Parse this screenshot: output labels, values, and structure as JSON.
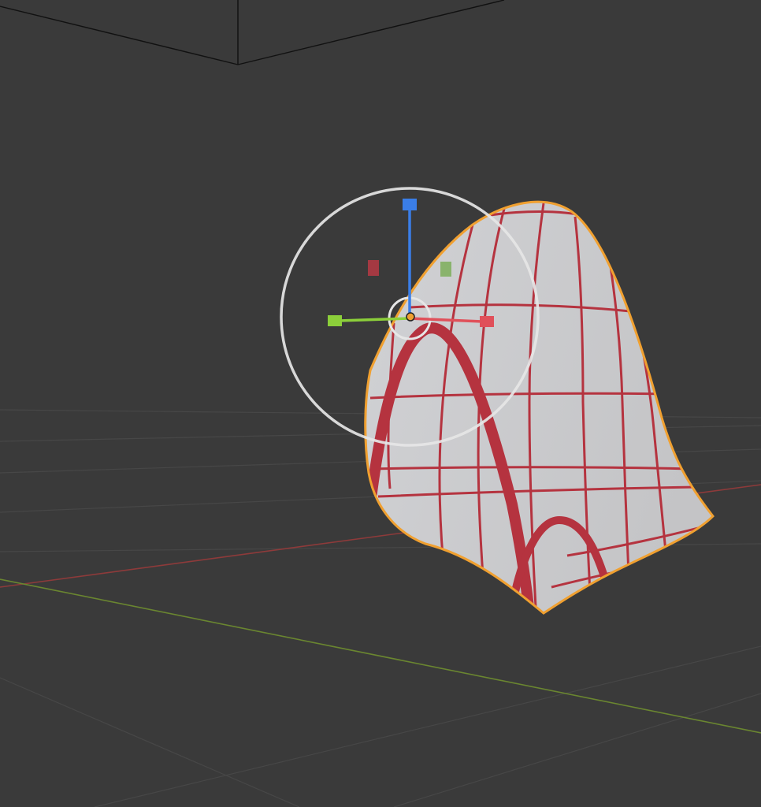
{
  "viewport": {
    "background": "#3a3a3a",
    "grid_color": "#4a4a4a",
    "axis_x_color": "#a23a3a",
    "axis_y_color": "#6f8c2a"
  },
  "object": {
    "surface_color": "#c9c9cc",
    "outline_color": "#f0a030",
    "wire_color": "#b5333f"
  },
  "gizmo": {
    "ring_color": "#e6e6e6",
    "x_axis_color": "#e0505a",
    "y_axis_color": "#8ccf3a",
    "z_axis_color": "#3a7ee8",
    "plane_xz_color": "#b03a44",
    "plane_yz_color": "#7dae5a",
    "origin_color": "#f0a030",
    "icons": [
      "translate-z-handle",
      "translate-x-handle",
      "translate-y-handle",
      "plane-handle"
    ]
  }
}
